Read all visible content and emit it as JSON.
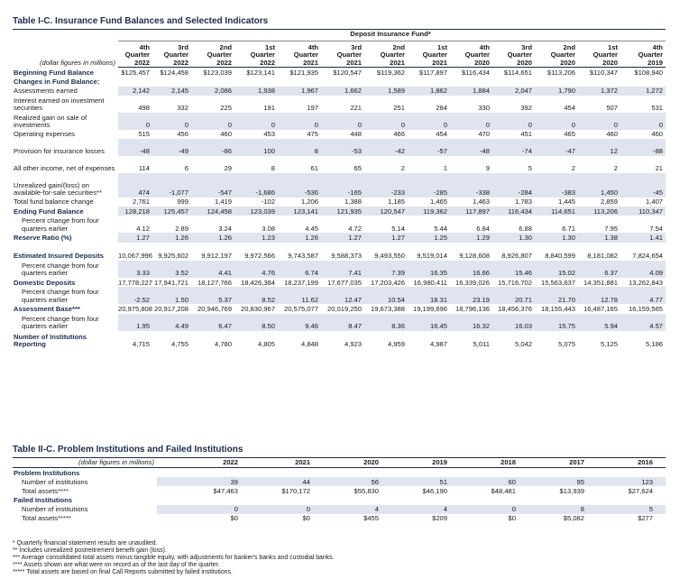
{
  "table1": {
    "title": "Table I-C.  Insurance Fund Balances and Selected Indicators",
    "group_header": "Deposit Insurance Fund*",
    "units_note": "(dollar figures in millions)",
    "columns": [
      {
        "l1": "4th",
        "l2": "Quarter",
        "l3": "2022"
      },
      {
        "l1": "3rd",
        "l2": "Quarter",
        "l3": "2022"
      },
      {
        "l1": "2nd",
        "l2": "Quarter",
        "l3": "2022"
      },
      {
        "l1": "1st",
        "l2": "Quarter",
        "l3": "2022"
      },
      {
        "l1": "4th",
        "l2": "Quarter",
        "l3": "2021"
      },
      {
        "l1": "3rd",
        "l2": "Quarter",
        "l3": "2021"
      },
      {
        "l1": "2nd",
        "l2": "Quarter",
        "l3": "2021"
      },
      {
        "l1": "1st",
        "l2": "Quarter",
        "l3": "2021"
      },
      {
        "l1": "4th",
        "l2": "Quarter",
        "l3": "2020"
      },
      {
        "l1": "3rd",
        "l2": "Quarter",
        "l3": "2020"
      },
      {
        "l1": "2nd",
        "l2": "Quarter",
        "l3": "2020"
      },
      {
        "l1": "1st",
        "l2": "Quarter",
        "l3": "2020"
      },
      {
        "l1": "4th",
        "l2": "Quarter",
        "l3": "2019"
      }
    ],
    "rows": [
      {
        "label": "Beginning Fund Balance",
        "style": "bold",
        "values": [
          "$125,457",
          "$124,458",
          "$123,039",
          "$123,141",
          "$121,935",
          "$120,547",
          "$119,362",
          "$117,897",
          "$116,434",
          "$114,651",
          "$113,206",
          "$110,347",
          "$108,940"
        ]
      },
      {
        "label": "Changes in Fund Balance:",
        "style": "bold",
        "values": [
          "",
          "",
          "",
          "",
          "",
          "",
          "",
          "",
          "",
          "",
          "",
          "",
          ""
        ]
      },
      {
        "label": "Assessments earned",
        "style": "",
        "shade": true,
        "values": [
          "2,142",
          "2,145",
          "2,086",
          "1,938",
          "1,967",
          "1,662",
          "1,589",
          "1,862",
          "1,884",
          "2,047",
          "1,790",
          "1,372",
          "1,272"
        ]
      },
      {
        "label": "Interest earned on investment securities",
        "style": "wrap",
        "values": [
          "498",
          "332",
          "225",
          "191",
          "197",
          "221",
          "251",
          "284",
          "330",
          "392",
          "454",
          "507",
          "531"
        ]
      },
      {
        "label": "Realized gain on sale of investments",
        "style": "wrap",
        "shade": true,
        "values": [
          "0",
          "0",
          "0",
          "0",
          "0",
          "0",
          "0",
          "0",
          "0",
          "0",
          "0",
          "0",
          "0"
        ]
      },
      {
        "label": "Operating expenses",
        "style": "",
        "values": [
          "515",
          "456",
          "460",
          "453",
          "475",
          "448",
          "466",
          "454",
          "470",
          "451",
          "465",
          "460",
          "460"
        ]
      },
      {
        "label": "Provision for insurance losses",
        "style": "wrap",
        "shade": true,
        "values": [
          "-48",
          "-49",
          "-86",
          "100",
          "8",
          "-53",
          "-42",
          "-57",
          "-48",
          "-74",
          "-47",
          "12",
          "-88"
        ]
      },
      {
        "label": "All other income, net of expenses",
        "style": "wrap",
        "values": [
          "114",
          "6",
          "29",
          "8",
          "61",
          "65",
          "2",
          "1",
          "9",
          "5",
          "2",
          "2",
          "21"
        ]
      },
      {
        "label": "Unrealized gain/(loss) on available-for-sale securities**",
        "style": "wrap3",
        "shade": true,
        "values": [
          "474",
          "-1,077",
          "-547",
          "-1,686",
          "-536",
          "-165",
          "-233",
          "-285",
          "-338",
          "-284",
          "-383",
          "1,450",
          "-45"
        ]
      },
      {
        "label": "Total fund balance change",
        "style": "",
        "values": [
          "2,761",
          "999",
          "1,419",
          "-102",
          "1,206",
          "1,388",
          "1,185",
          "1,465",
          "1,463",
          "1,783",
          "1,445",
          "2,859",
          "1,407"
        ]
      },
      {
        "label": "Ending Fund Balance",
        "style": "bold",
        "shade": true,
        "highlight_first": true,
        "values": [
          "128,218",
          "125,457",
          "124,458",
          "123,039",
          "123,141",
          "121,935",
          "120,547",
          "119,362",
          "117,897",
          "116,434",
          "114,651",
          "113,206",
          "110,347"
        ]
      },
      {
        "label": "Percent change from four quarters earlier",
        "style": "pct",
        "values": [
          "4.12",
          "2.89",
          "3.24",
          "3.08",
          "4.45",
          "4.72",
          "5.14",
          "5.44",
          "6.84",
          "6.88",
          "6.71",
          "7.95",
          "7.54"
        ]
      },
      {
        "label": "Reserve Ratio (%)",
        "style": "bold",
        "shade": true,
        "values": [
          "1.27",
          "1.26",
          "1.26",
          "1.23",
          "1.26",
          "1.27",
          "1.27",
          "1.25",
          "1.29",
          "1.30",
          "1.30",
          "1.38",
          "1.41"
        ]
      },
      {
        "label": "Estimated Insured Deposits",
        "style": "boldwrap",
        "values": [
          "10,067,996",
          "9,925,602",
          "9,912,197",
          "9,972,566",
          "9,743,587",
          "9,588,373",
          "9,493,550",
          "9,519,014",
          "9,128,608",
          "8,926,807",
          "8,840,599",
          "8,181,082",
          "7,824,654"
        ]
      },
      {
        "label": "Percent change from four quarters earlier",
        "style": "pct",
        "shade": true,
        "values": [
          "3.33",
          "3.52",
          "4.41",
          "4.76",
          "6.74",
          "7.41",
          "7.39",
          "16.35",
          "16.66",
          "15.46",
          "15.02",
          "6.37",
          "4.09"
        ]
      },
      {
        "label": "Domestic Deposits",
        "style": "bold",
        "values": [
          "17,778,227",
          "17,941,721",
          "18,127,766",
          "18,426,384",
          "18,237,199",
          "17,677,035",
          "17,203,426",
          "16,980,411",
          "16,339,026",
          "15,716,702",
          "15,563,637",
          "14,351,881",
          "13,262,843"
        ]
      },
      {
        "label": "Percent change from four quarters earlier",
        "style": "pct",
        "shade": true,
        "values": [
          "-2.52",
          "1.50",
          "5.37",
          "8.52",
          "11.62",
          "12.47",
          "10.54",
          "18.31",
          "23.19",
          "20.71",
          "21.70",
          "12.78",
          "4.77"
        ]
      },
      {
        "label": "Assessment Base***",
        "style": "bold",
        "values": [
          "20,975,808",
          "20,917,208",
          "20,946,769",
          "20,830,967",
          "20,575,077",
          "20,019,250",
          "19,673,388",
          "19,199,696",
          "18,796,136",
          "18,456,376",
          "18,155,443",
          "16,487,165",
          "16,159,565"
        ]
      },
      {
        "label": "Percent change from four quarters earlier",
        "style": "pct",
        "shade": true,
        "values": [
          "1.95",
          "4.49",
          "6.47",
          "8.50",
          "9.46",
          "8.47",
          "8.36",
          "16.45",
          "16.32",
          "16.03",
          "15.75",
          "5.94",
          "4.57"
        ]
      },
      {
        "label": "Number of Institutions Reporting",
        "style": "boldwrap",
        "values": [
          "4,715",
          "4,755",
          "4,780",
          "4,805",
          "4,848",
          "4,923",
          "4,959",
          "4,987",
          "5,011",
          "5,042",
          "5,075",
          "5,125",
          "5,186"
        ]
      }
    ]
  },
  "table2": {
    "title": "Table II-C.  Problem Institutions and Failed Institutions",
    "units_note": "(dollar figures in millions)",
    "years": [
      "2022",
      "2021",
      "2020",
      "2019",
      "2018",
      "2017",
      "2016"
    ],
    "sections": [
      {
        "heading": "Problem Institutions",
        "rows": [
          {
            "label": "Number of institutions",
            "values": [
              "39",
              "44",
              "56",
              "51",
              "60",
              "95",
              "123"
            ]
          },
          {
            "label": "Total assets****",
            "values": [
              "$47,463",
              "$170,172",
              "$55,830",
              "$46,190",
              "$48,481",
              "$13,939",
              "$27,624"
            ]
          }
        ]
      },
      {
        "heading": "Failed Institutions",
        "rows": [
          {
            "label": "Number of institutions",
            "values": [
              "0",
              "0",
              "4",
              "4",
              "0",
              "8",
              "5"
            ]
          },
          {
            "label": "Total assets*****",
            "values": [
              "$0",
              "$0",
              "$455",
              "$209",
              "$0",
              "$5,082",
              "$277"
            ]
          }
        ]
      }
    ]
  },
  "footnotes": [
    "* Quarterly financial statement results are unaudited.",
    "** Includes unrealized postretirement benefit gain (loss).",
    "*** Average consolidated total assets minus tangible equity, with adjustments for banker's banks and custodial banks.",
    "**** Assets shown are what were on record as of the last day of the quarter.",
    "***** Total assets are based on final Call Reports submitted by failed institutions."
  ],
  "colors": {
    "title": "#1b2c4e",
    "shade": "#dfe4ee",
    "highlight": "#f3ef3c"
  }
}
